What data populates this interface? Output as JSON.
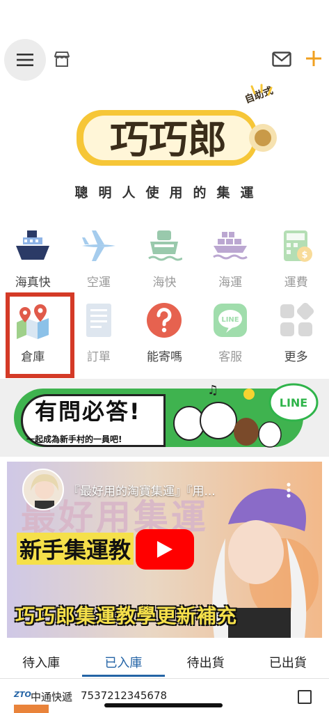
{
  "tagline": "聰明人使用的集運",
  "logo": {
    "brand": "巧巧郎",
    "badge": "自助式"
  },
  "grid": [
    [
      {
        "label": "海真快",
        "icon": "ship-icon",
        "faded": false
      },
      {
        "label": "空運",
        "icon": "airplane-icon",
        "faded": true
      },
      {
        "label": "海快",
        "icon": "ferry-icon",
        "faded": true
      },
      {
        "label": "海運",
        "icon": "cargo-ship-icon",
        "faded": true
      },
      {
        "label": "運費",
        "icon": "calculator-icon",
        "faded": true
      }
    ],
    [
      {
        "label": "倉庫",
        "icon": "map-pin-icon",
        "faded": false
      },
      {
        "label": "訂單",
        "icon": "document-icon",
        "faded": true
      },
      {
        "label": "能寄嗎",
        "icon": "question-icon",
        "faded": false
      },
      {
        "label": "客服",
        "icon": "line-icon",
        "faded": true
      },
      {
        "label": "更多",
        "icon": "more-grid-icon",
        "faded": false
      }
    ]
  ],
  "banner": {
    "title": "有問必答!",
    "subtitle": "一起成為新手村的一員吧!",
    "badge": "LINE"
  },
  "video": {
    "title": "『最好用的淘寶集運』『用...",
    "overlay_big": "最好用集運",
    "overlay_mid": "新手集運教",
    "overlay_bottom": "巧巧郎集運教學更新補充"
  },
  "tabs": [
    {
      "label": "待入庫",
      "active": false
    },
    {
      "label": "已入庫",
      "active": true
    },
    {
      "label": "待出貨",
      "active": false
    },
    {
      "label": "已出貨",
      "active": false
    }
  ],
  "package": {
    "courier_logo": "ZTO",
    "courier": "中通快遞",
    "tracking": "7537212345678"
  },
  "colors": {
    "accent": "#2464a6",
    "highlight": "#d43a27",
    "plus": "#f0a020",
    "banner_green": "#3fb34f"
  }
}
